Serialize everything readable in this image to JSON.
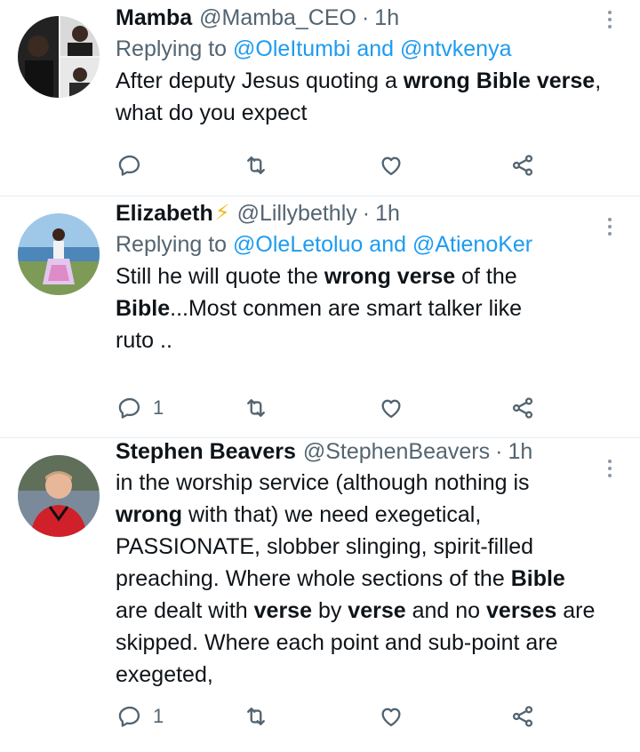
{
  "tweets": [
    {
      "name": "Mamba",
      "handle": "@Mamba_CEO",
      "sep": "·",
      "time": "1h",
      "reply_prefix": "Replying to",
      "reply_mention1": "@OleItumbi",
      "reply_and": "and",
      "reply_mention2": "@ntvkenya",
      "body_parts": [
        "After deputy Jesus quoting a ",
        "wrong Bible verse",
        ",",
        "what do you expect"
      ],
      "reply_count": "",
      "icons": [
        "reply-icon",
        "retweet-icon",
        "like-icon",
        "share-icon",
        "more-icon"
      ]
    },
    {
      "name": "Elizabeth",
      "name_emoji": "⚡",
      "handle": "@Lillybethly",
      "sep": "·",
      "time": "1h",
      "reply_prefix": "Replying to",
      "reply_mention1": "@OleLetoluo",
      "reply_and": "and",
      "reply_mention2": "@AtienoKer",
      "body_parts": [
        "Still he will quote the ",
        "wrong verse",
        " of the",
        "Bible",
        "...Most conmen are smart talker like",
        "ruto .."
      ],
      "reply_count": "1"
    },
    {
      "name": "Stephen Beavers",
      "handle": "@StephenBeavers",
      "sep": "·",
      "time": "1h",
      "body_parts": [
        "in the worship service (although nothing is",
        "wrong",
        " with that) we need exegetical,",
        "PASSIONATE, slobber slinging, spirit-filled",
        "preaching. Where whole sections of the ",
        "Bible",
        "are dealt with ",
        "verse",
        " by ",
        "verse",
        " and no ",
        "verses",
        " are",
        "skipped. Where each point and sub-point are",
        "exegeted,"
      ],
      "reply_count": "1"
    }
  ]
}
